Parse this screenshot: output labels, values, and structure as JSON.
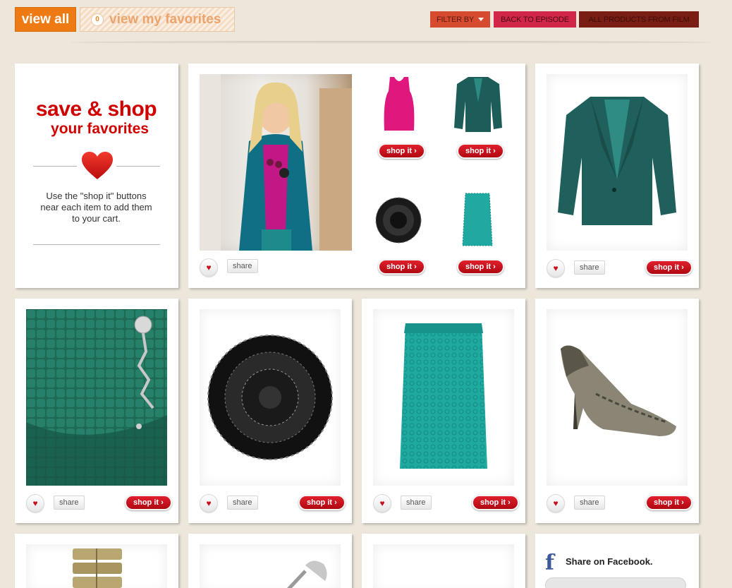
{
  "header": {
    "view_all": "view all",
    "favorites_count": "0",
    "view_favorites": "view my favorites",
    "filter_by": "FILTER BY",
    "back_to_episode": "BACK TO EPISODE",
    "all_products": "ALL PRODUCTS FROM FILM"
  },
  "intro": {
    "title_line1": "save & shop",
    "title_line2": "your favorites",
    "instructions": "Use the \"shop it\" buttons near each item to add them to your cart."
  },
  "labels": {
    "share": "share",
    "shop_it": "shop it ›"
  },
  "products": [
    {
      "name": "look",
      "items": [
        "pink-tank",
        "teal-blazer",
        "black-flower-brooch",
        "teal-lace-skirt"
      ]
    },
    {
      "name": "teal-blazer"
    },
    {
      "name": "green-croc-bag"
    },
    {
      "name": "black-flower-brooch"
    },
    {
      "name": "teal-lace-skirt"
    },
    {
      "name": "snakeskin-pumps"
    },
    {
      "name": "gold-watch"
    },
    {
      "name": "silver-lamp"
    },
    {
      "name": "blank"
    }
  ],
  "facebook": {
    "share_label": "Share on Facebook.",
    "icon": "facebook-icon"
  },
  "colors": {
    "background": "#ece6db",
    "accent_orange": "#ee7a14",
    "brand_red": "#d10000",
    "shop_button": "#c8101d"
  }
}
